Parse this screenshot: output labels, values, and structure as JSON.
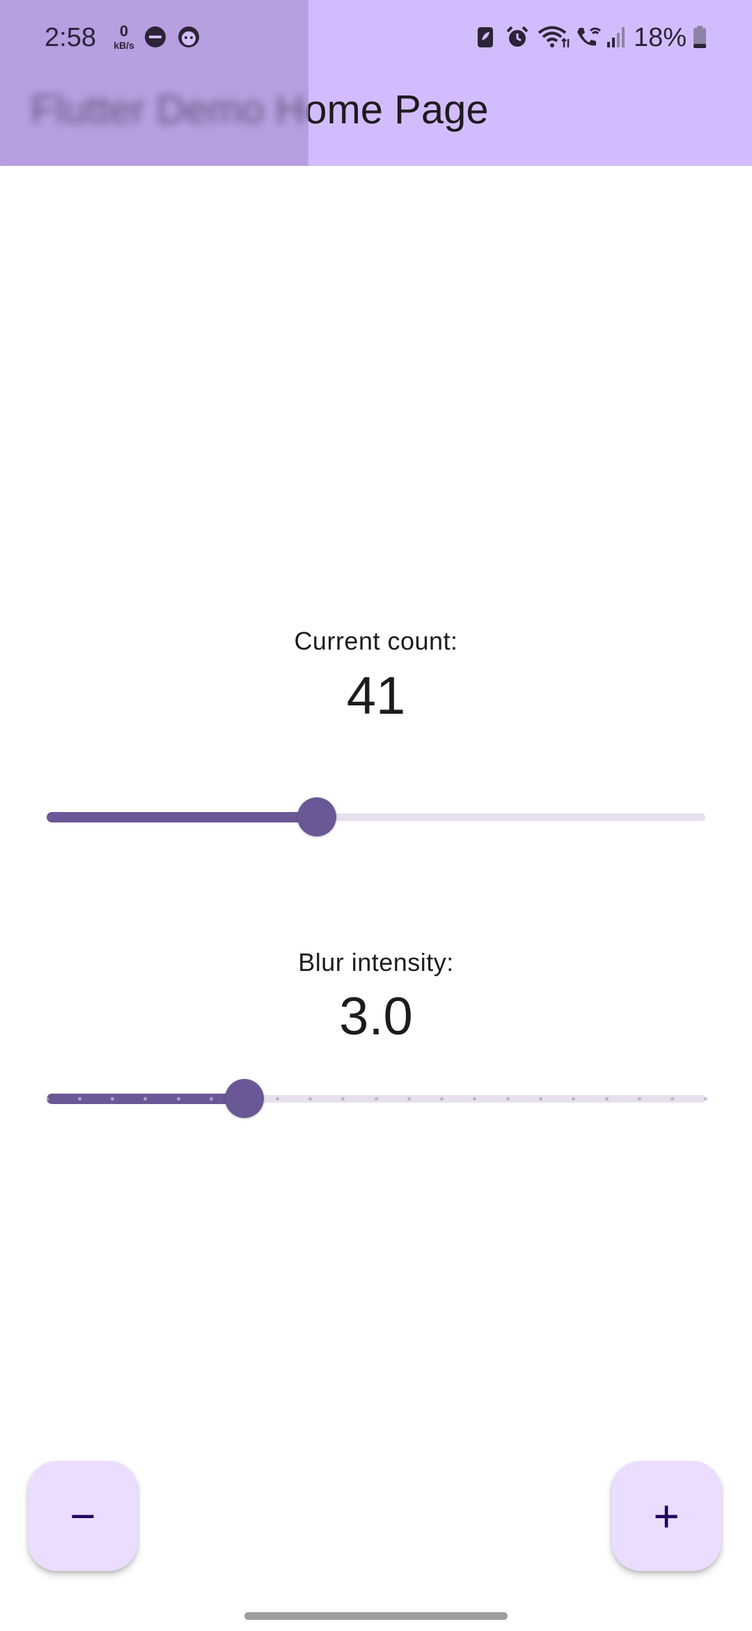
{
  "status_bar": {
    "time": "2:58",
    "net_speed_value": "0",
    "net_speed_unit": "kB/s",
    "battery_percent": "18%",
    "left_icons": [
      "do-not-disturb-icon",
      "face-icon"
    ],
    "right_icons": [
      "battery-saver-icon",
      "alarm-icon",
      "wifi-icon",
      "wifi-calling-icon",
      "signal-icon",
      "battery-icon"
    ]
  },
  "app_bar": {
    "title": "Flutter Demo Home Page"
  },
  "counter": {
    "label": "Current count:",
    "value": "41",
    "slider_fraction": 0.41
  },
  "blur": {
    "label": "Blur intensity:",
    "value": "3.0",
    "slider_fraction": 0.3,
    "divisions": 20
  },
  "fabs": {
    "decrement_label": "−",
    "increment_label": "+"
  },
  "colors": {
    "app_bar": "#d3bcfd",
    "primary": "#6a5896",
    "track_inactive": "#e7e0ec",
    "fab_background": "#eaddff"
  }
}
